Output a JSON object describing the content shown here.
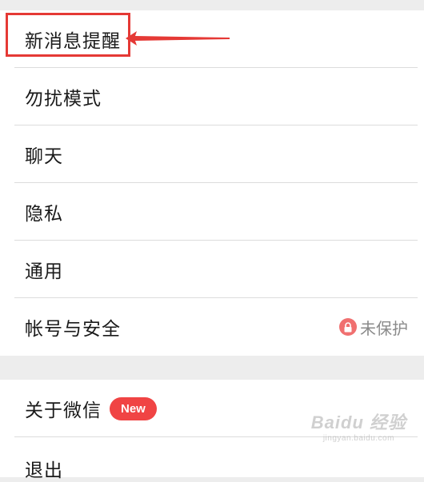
{
  "settings": {
    "group1": [
      {
        "label": "新消息提醒"
      },
      {
        "label": "勿扰模式"
      },
      {
        "label": "聊天"
      },
      {
        "label": "隐私"
      },
      {
        "label": "通用"
      },
      {
        "label": "帐号与安全",
        "status": "未保护"
      }
    ],
    "group2": [
      {
        "label": "关于微信",
        "badge": "New"
      },
      {
        "label": "退出"
      }
    ]
  },
  "watermark": {
    "main": "Baidu 经验",
    "sub": "jingyan.baidu.com"
  },
  "colors": {
    "accent_red": "#e53935",
    "badge_red": "#f04444",
    "lock_red": "#f07070",
    "background": "#ededed"
  },
  "icons": {
    "lock": "lock-icon",
    "arrow": "arrow-left-icon"
  }
}
